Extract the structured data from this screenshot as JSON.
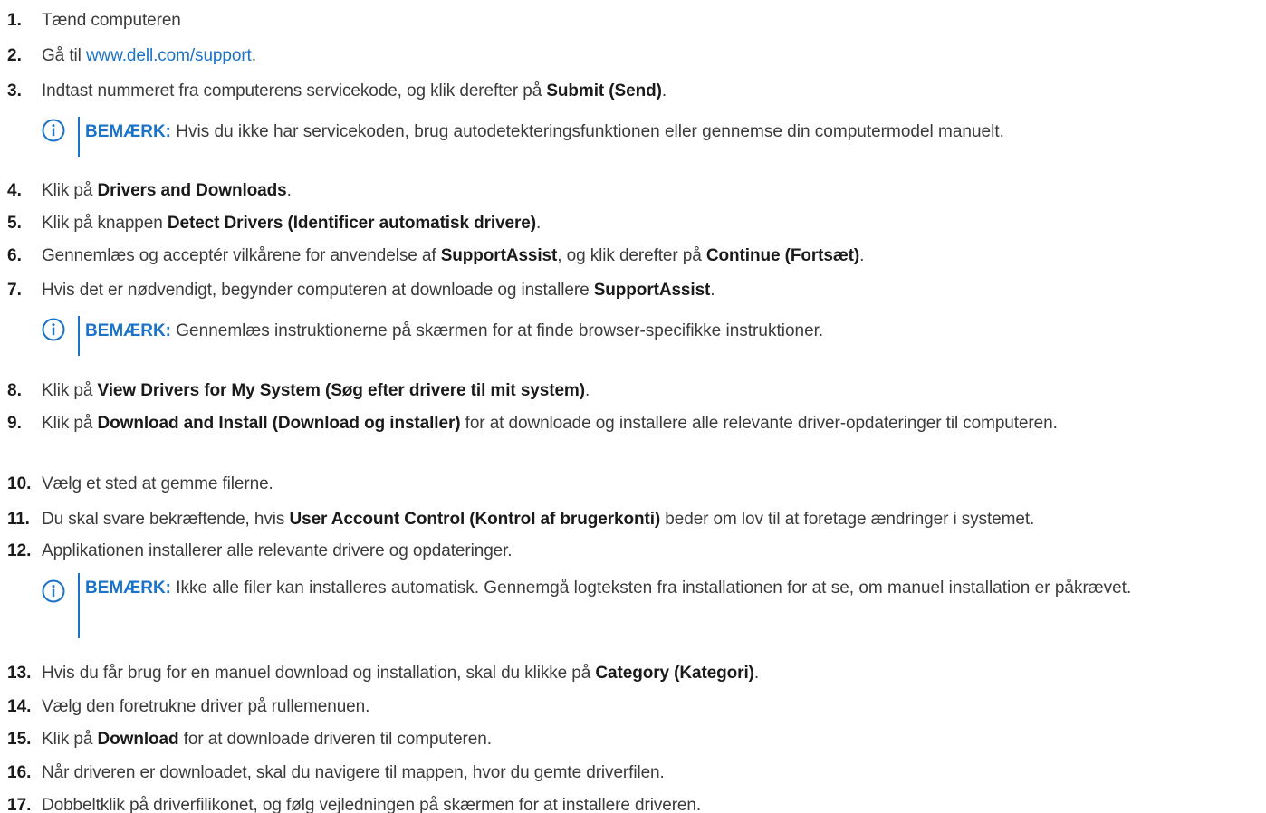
{
  "steps": [
    {
      "num": "1.",
      "text": "Tænd computeren"
    },
    {
      "num": "2.",
      "pre": "Gå til ",
      "link": "www.dell.com/support",
      "post": "."
    },
    {
      "num": "3.",
      "pre": "Indtast nummeret fra computerens servicekode, og klik derefter på ",
      "bold": "Submit (Send)",
      "post": "."
    },
    {
      "num": "4.",
      "pre": "Klik på ",
      "bold": "Drivers and Downloads",
      "post": "."
    },
    {
      "num": "5.",
      "pre": "Klik på knappen ",
      "bold": "Detect Drivers (Identificer automatisk drivere)",
      "post": "."
    },
    {
      "num": "6.",
      "pre": "Gennemlæs og acceptér vilkårene for anvendelse af ",
      "bold": "SupportAssist",
      "mid": ", og klik derefter på ",
      "bold2": "Continue (Fortsæt)",
      "post": "."
    },
    {
      "num": "7.",
      "pre": "Hvis det er nødvendigt, begynder computeren at downloade og installere ",
      "bold": "SupportAssist",
      "post": "."
    },
    {
      "num": "8.",
      "pre": "Klik på ",
      "bold": "View Drivers for My System (Søg efter drivere til mit system)",
      "post": "."
    },
    {
      "num": "9.",
      "pre": "Klik på ",
      "bold": "Download and Install (Download og installer)",
      "post": " for at downloade og installere alle relevante driver-opdateringer til computeren."
    },
    {
      "num": "10.",
      "text": "Vælg et sted at gemme filerne."
    },
    {
      "num": "11.",
      "pre": "Du skal svare bekræftende, hvis ",
      "bold": "User Account Control (Kontrol af brugerkonti)",
      "post": " beder om lov til at foretage ændringer i systemet."
    },
    {
      "num": "12.",
      "text": "Applikationen installerer alle relevante drivere og opdateringer."
    },
    {
      "num": "13.",
      "pre": "Hvis du får brug for en manuel download og installation, skal du klikke på ",
      "bold": "Category (Kategori)",
      "post": "."
    },
    {
      "num": "14.",
      "text": "Vælg den foretrukne driver på rullemenuen."
    },
    {
      "num": "15.",
      "pre": "Klik på ",
      "bold": "Download",
      "post": " for at downloade driveren til computeren."
    },
    {
      "num": "16.",
      "text": "Når driveren er downloadet, skal du navigere til mappen, hvor du gemte driverfilen."
    },
    {
      "num": "17.",
      "text": "Dobbeltklik på driverfilikonet, og følg vejledningen på skærmen for at installere driveren."
    }
  ],
  "notes": [
    {
      "label": "BEMÆRK:",
      "text": " Hvis du ikke har servicekoden, brug autodetekteringsfunktionen eller gennemse din computermodel manuelt."
    },
    {
      "label": "BEMÆRK:",
      "text": " Gennemlæs instruktionerne på skærmen for at finde browser-specifikke instruktioner."
    },
    {
      "label": "BEMÆRK:",
      "text": " Ikke alle filer kan installeres automatisk. Gennemgå logteksten fra installationen for at se, om manuel installation er påkrævet."
    }
  ],
  "colors": {
    "link": "#1a73c9",
    "text": "#3b3b3b"
  },
  "icons": {
    "note": "info-circle-icon"
  }
}
